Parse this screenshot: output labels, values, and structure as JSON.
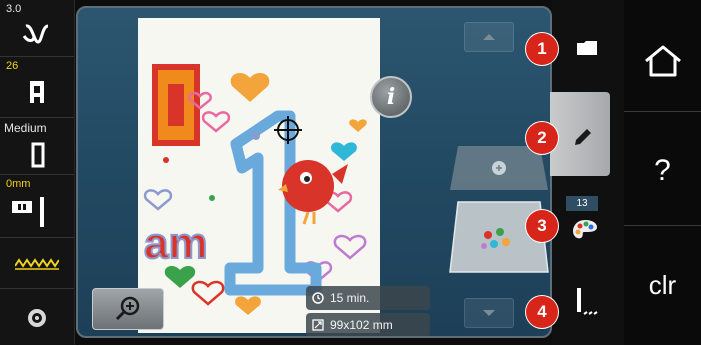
{
  "status_column": {
    "stitch_width_value": "3.0",
    "presser_foot_value": "26",
    "tension_label": "Medium",
    "needle_position_value": "0mm"
  },
  "workspace": {
    "design_time": "15 min.",
    "design_size": "99x102 mm",
    "info_glyph": "i"
  },
  "tabs": {
    "badge_1": "1",
    "badge_2": "2",
    "badge_3": "3",
    "badge_4": "4",
    "color_count": "13"
  },
  "nav": {
    "help_label": "?",
    "clear_label": "clr"
  },
  "design": {
    "letter_i": "I",
    "word_am": "am",
    "number_1": "1"
  },
  "colors": {
    "accent_badge": "#d8251a",
    "status_yellow": "#f2d21a",
    "workspace_blue": "#234a63",
    "letter_orange": "#f08a1c",
    "letter_red": "#d8342a",
    "number_blue": "#6aa9dc"
  },
  "icons": [
    "folder-icon",
    "pencil-icon",
    "color-palette-icon",
    "stitch-edit-icon",
    "home-icon",
    "zoom-in-icon",
    "clock-icon",
    "size-icon",
    "crosshair-icon",
    "info-icon"
  ]
}
